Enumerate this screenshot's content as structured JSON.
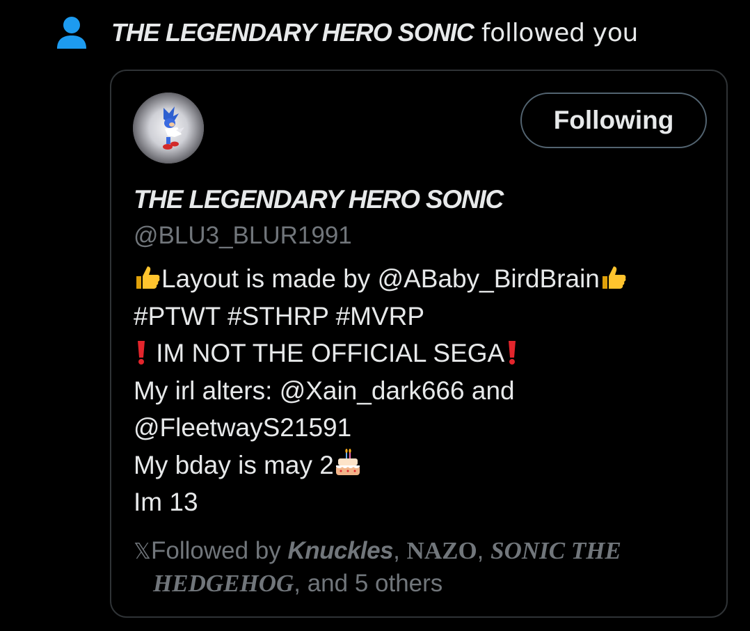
{
  "notification": {
    "icon": "person-icon",
    "name": "THE LEGENDARY HERO SONIC",
    "action": " followed you"
  },
  "card": {
    "avatar_alt": "profile picture",
    "follow_button": "Following",
    "display_name": "THE LEGENDARY HERO SONIC",
    "handle": "@BLU3_BLUR1991",
    "bio": {
      "line1_pre": "Layout is made by ",
      "line1_link": "@ABaby_BirdBrain",
      "line2": "#PTWT #STHRP #MVRP",
      "line3": " IM NOT THE OFFICIAL SEGA",
      "line4_pre": "My irl alters: ",
      "line4_link": "@Xain_dark666",
      "line4_post": " and",
      "line5_link": "@FleetwayS21591",
      "line6": "My bday is may 2",
      "line7": "Im 13"
    },
    "followed_by": {
      "x_logo": "𝕏",
      "prefix": "Followed by ",
      "follower1": "Knuckles",
      "sep1": ", ",
      "follower2": "NAZO",
      "sep2": ", ",
      "follower3_part1": "SONIC THE",
      "follower3_part2": "HEDGEHOG",
      "suffix": ", and 5 others"
    }
  },
  "colors": {
    "background": "#000000",
    "text_primary": "#e7e9ea",
    "text_secondary": "#71767b",
    "border": "#2f3336",
    "button_border": "#536471",
    "person_icon": "#1d9bf0"
  },
  "icons": {
    "thumbs_up": "thumbs-up-emoji",
    "exclamation": "red-exclamation-emoji",
    "cake": "birthday-cake-emoji"
  }
}
